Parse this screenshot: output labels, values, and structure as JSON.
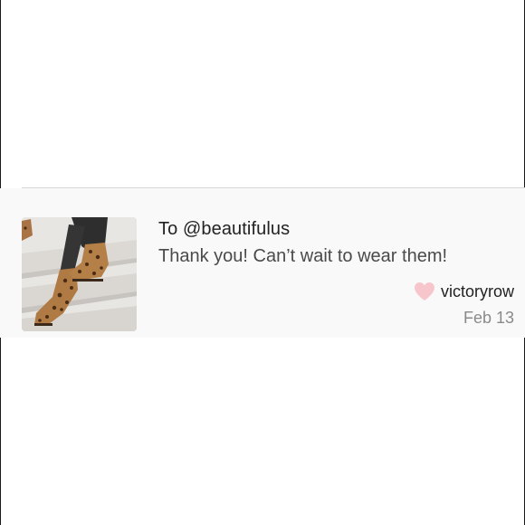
{
  "comment": {
    "recipient": "To @beautifulus",
    "message": "Thank you! Can’t wait to wear them!",
    "author": "victoryrow",
    "date": "Feb 13",
    "heart_color": "#f7c6cc",
    "thumbnail": "leopard-print ankle boots on stairs"
  },
  "colors": {
    "text_primary": "#222222",
    "text_secondary": "#4a4a4a",
    "text_muted": "#8a8a8a",
    "card_background": "#f9f9f9"
  }
}
